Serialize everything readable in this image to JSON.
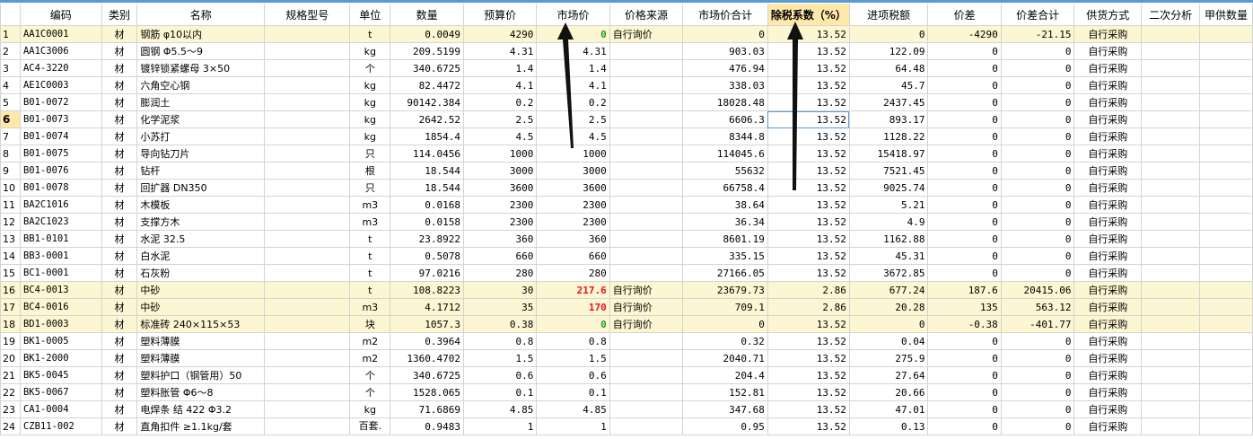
{
  "headers": [
    "",
    "编码",
    "类别",
    "名称",
    "规格型号",
    "单位",
    "数量",
    "预算价",
    "市场价",
    "价格来源",
    "市场价合计",
    "除税系数（%）",
    "进项税额",
    "价差",
    "价差合计",
    "供货方式",
    "二次分析",
    "甲供数量"
  ],
  "rows": [
    {
      "n": "1",
      "code": "AA1C0001",
      "cat": "材",
      "name": "钢筋 φ10以内",
      "spec": "",
      "unit": "t",
      "qty": "0.0049",
      "budget": "4290",
      "market": "0",
      "source": "自行询价",
      "mtotal": "0",
      "coef": "13.52",
      "tax": "0",
      "diff": "-4290",
      "dtotal": "-21.15",
      "supply": "自行采购",
      "hl": true,
      "mstyle": "green"
    },
    {
      "n": "2",
      "code": "AA1C3006",
      "cat": "材",
      "name": "圆钢 Φ5.5～9",
      "spec": "",
      "unit": "kg",
      "qty": "209.5199",
      "budget": "4.31",
      "market": "4.31",
      "source": "",
      "mtotal": "903.03",
      "coef": "13.52",
      "tax": "122.09",
      "diff": "0",
      "dtotal": "0",
      "supply": "自行采购"
    },
    {
      "n": "3",
      "code": "AC4-3220",
      "cat": "材",
      "name": "镀锌锁紧螺母 3×50",
      "spec": "",
      "unit": "个",
      "qty": "340.6725",
      "budget": "1.4",
      "market": "1.4",
      "source": "",
      "mtotal": "476.94",
      "coef": "13.52",
      "tax": "64.48",
      "diff": "0",
      "dtotal": "0",
      "supply": "自行采购"
    },
    {
      "n": "4",
      "code": "AE1C0003",
      "cat": "材",
      "name": "六角空心钢",
      "spec": "",
      "unit": "kg",
      "qty": "82.4472",
      "budget": "4.1",
      "market": "4.1",
      "source": "",
      "mtotal": "338.03",
      "coef": "13.52",
      "tax": "45.7",
      "diff": "0",
      "dtotal": "0",
      "supply": "自行采购"
    },
    {
      "n": "5",
      "code": "B01-0072",
      "cat": "材",
      "name": "膨润土",
      "spec": "",
      "unit": "kg",
      "qty": "90142.384",
      "budget": "0.2",
      "market": "0.2",
      "source": "",
      "mtotal": "18028.48",
      "coef": "13.52",
      "tax": "2437.45",
      "diff": "0",
      "dtotal": "0",
      "supply": "自行采购"
    },
    {
      "n": "6",
      "code": "B01-0073",
      "cat": "材",
      "name": "化学泥浆",
      "spec": "",
      "unit": "kg",
      "qty": "2642.52",
      "budget": "2.5",
      "market": "2.5",
      "source": "",
      "mtotal": "6606.3",
      "coef": "13.52",
      "tax": "893.17",
      "diff": "0",
      "dtotal": "0",
      "supply": "自行采购",
      "cur": true
    },
    {
      "n": "7",
      "code": "B01-0074",
      "cat": "材",
      "name": "小苏打",
      "spec": "",
      "unit": "kg",
      "qty": "1854.4",
      "budget": "4.5",
      "market": "4.5",
      "source": "",
      "mtotal": "8344.8",
      "coef": "13.52",
      "tax": "1128.22",
      "diff": "0",
      "dtotal": "0",
      "supply": "自行采购"
    },
    {
      "n": "8",
      "code": "B01-0075",
      "cat": "材",
      "name": "导向钻刀片",
      "spec": "",
      "unit": "只",
      "qty": "114.0456",
      "budget": "1000",
      "market": "1000",
      "source": "",
      "mtotal": "114045.6",
      "coef": "13.52",
      "tax": "15418.97",
      "diff": "0",
      "dtotal": "0",
      "supply": "自行采购"
    },
    {
      "n": "9",
      "code": "B01-0076",
      "cat": "材",
      "name": "钻杆",
      "spec": "",
      "unit": "根",
      "qty": "18.544",
      "budget": "3000",
      "market": "3000",
      "source": "",
      "mtotal": "55632",
      "coef": "13.52",
      "tax": "7521.45",
      "diff": "0",
      "dtotal": "0",
      "supply": "自行采购"
    },
    {
      "n": "10",
      "code": "B01-0078",
      "cat": "材",
      "name": "回扩器 DN350",
      "spec": "",
      "unit": "只",
      "qty": "18.544",
      "budget": "3600",
      "market": "3600",
      "source": "",
      "mtotal": "66758.4",
      "coef": "13.52",
      "tax": "9025.74",
      "diff": "0",
      "dtotal": "0",
      "supply": "自行采购"
    },
    {
      "n": "11",
      "code": "BA2C1016",
      "cat": "材",
      "name": "木模板",
      "spec": "",
      "unit": "m3",
      "qty": "0.0168",
      "budget": "2300",
      "market": "2300",
      "source": "",
      "mtotal": "38.64",
      "coef": "13.52",
      "tax": "5.21",
      "diff": "0",
      "dtotal": "0",
      "supply": "自行采购"
    },
    {
      "n": "12",
      "code": "BA2C1023",
      "cat": "材",
      "name": "支撑方木",
      "spec": "",
      "unit": "m3",
      "qty": "0.0158",
      "budget": "2300",
      "market": "2300",
      "source": "",
      "mtotal": "36.34",
      "coef": "13.52",
      "tax": "4.9",
      "diff": "0",
      "dtotal": "0",
      "supply": "自行采购"
    },
    {
      "n": "13",
      "code": "BB1-0101",
      "cat": "材",
      "name": "水泥 32.5",
      "spec": "",
      "unit": "t",
      "qty": "23.8922",
      "budget": "360",
      "market": "360",
      "source": "",
      "mtotal": "8601.19",
      "coef": "13.52",
      "tax": "1162.88",
      "diff": "0",
      "dtotal": "0",
      "supply": "自行采购"
    },
    {
      "n": "14",
      "code": "BB3-0001",
      "cat": "材",
      "name": "白水泥",
      "spec": "",
      "unit": "t",
      "qty": "0.5078",
      "budget": "660",
      "market": "660",
      "source": "",
      "mtotal": "335.15",
      "coef": "13.52",
      "tax": "45.31",
      "diff": "0",
      "dtotal": "0",
      "supply": "自行采购"
    },
    {
      "n": "15",
      "code": "BC1-0001",
      "cat": "材",
      "name": "石灰粉",
      "spec": "",
      "unit": "t",
      "qty": "97.0216",
      "budget": "280",
      "market": "280",
      "source": "",
      "mtotal": "27166.05",
      "coef": "13.52",
      "tax": "3672.85",
      "diff": "0",
      "dtotal": "0",
      "supply": "自行采购"
    },
    {
      "n": "16",
      "code": "BC4-0013",
      "cat": "材",
      "name": "中砂",
      "spec": "",
      "unit": "t",
      "qty": "108.8223",
      "budget": "30",
      "market": "217.6",
      "source": "自行询价",
      "mtotal": "23679.73",
      "coef": "2.86",
      "tax": "677.24",
      "diff": "187.6",
      "dtotal": "20415.06",
      "supply": "自行采购",
      "hl": true,
      "mstyle": "red"
    },
    {
      "n": "17",
      "code": "BC4-0016",
      "cat": "材",
      "name": "中砂",
      "spec": "",
      "unit": "m3",
      "qty": "4.1712",
      "budget": "35",
      "market": "170",
      "source": "自行询价",
      "mtotal": "709.1",
      "coef": "2.86",
      "tax": "20.28",
      "diff": "135",
      "dtotal": "563.12",
      "supply": "自行采购",
      "hl": true,
      "mstyle": "red"
    },
    {
      "n": "18",
      "code": "BD1-0003",
      "cat": "材",
      "name": "标准砖 240×115×53",
      "spec": "",
      "unit": "块",
      "qty": "1057.3",
      "budget": "0.38",
      "market": "0",
      "source": "自行询价",
      "mtotal": "0",
      "coef": "13.52",
      "tax": "0",
      "diff": "-0.38",
      "dtotal": "-401.77",
      "supply": "自行采购",
      "hl": true,
      "mstyle": "green"
    },
    {
      "n": "19",
      "code": "BK1-0005",
      "cat": "材",
      "name": "塑料薄膜",
      "spec": "",
      "unit": "m2",
      "qty": "0.3964",
      "budget": "0.8",
      "market": "0.8",
      "source": "",
      "mtotal": "0.32",
      "coef": "13.52",
      "tax": "0.04",
      "diff": "0",
      "dtotal": "0",
      "supply": "自行采购"
    },
    {
      "n": "20",
      "code": "BK1-2000",
      "cat": "材",
      "name": "塑料薄膜",
      "spec": "",
      "unit": "m2",
      "qty": "1360.4702",
      "budget": "1.5",
      "market": "1.5",
      "source": "",
      "mtotal": "2040.71",
      "coef": "13.52",
      "tax": "275.9",
      "diff": "0",
      "dtotal": "0",
      "supply": "自行采购"
    },
    {
      "n": "21",
      "code": "BK5-0045",
      "cat": "材",
      "name": "塑料护口（钢管用）50",
      "spec": "",
      "unit": "个",
      "qty": "340.6725",
      "budget": "0.6",
      "market": "0.6",
      "source": "",
      "mtotal": "204.4",
      "coef": "13.52",
      "tax": "27.64",
      "diff": "0",
      "dtotal": "0",
      "supply": "自行采购"
    },
    {
      "n": "22",
      "code": "BK5-0067",
      "cat": "材",
      "name": "塑料胀管 Φ6～8",
      "spec": "",
      "unit": "个",
      "qty": "1528.065",
      "budget": "0.1",
      "market": "0.1",
      "source": "",
      "mtotal": "152.81",
      "coef": "13.52",
      "tax": "20.66",
      "diff": "0",
      "dtotal": "0",
      "supply": "自行采购"
    },
    {
      "n": "23",
      "code": "CA1-0004",
      "cat": "材",
      "name": "电焊条 结 422 Φ3.2",
      "spec": "",
      "unit": "kg",
      "qty": "71.6869",
      "budget": "4.85",
      "market": "4.85",
      "source": "",
      "mtotal": "347.68",
      "coef": "13.52",
      "tax": "47.01",
      "diff": "0",
      "dtotal": "0",
      "supply": "自行采购"
    },
    {
      "n": "24",
      "code": "CZB11-002",
      "cat": "材",
      "name": "直角扣件 ≥1.1kg/套",
      "spec": "",
      "unit": "百套.",
      "qty": "0.9483",
      "budget": "1",
      "market": "1",
      "source": "",
      "mtotal": "0.95",
      "coef": "13.52",
      "tax": "0.13",
      "diff": "0",
      "dtotal": "0",
      "supply": "自行采购"
    }
  ],
  "colors": {
    "highlight_row": "#fdf6d2",
    "selected_header": "#ffe8a8",
    "red_value": "#e8141e",
    "green_value": "#1aa01a"
  }
}
